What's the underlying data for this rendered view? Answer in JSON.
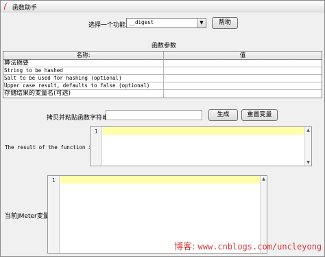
{
  "window": {
    "title": "函数助手"
  },
  "function_select": {
    "label": "选择一个功能",
    "value": "__digest",
    "arrow": "▼"
  },
  "buttons": {
    "help": "帮助",
    "generate": "生成",
    "reset": "重置变量"
  },
  "params": {
    "title": "函数参数",
    "columns": [
      "名称:",
      "值"
    ],
    "rows": [
      {
        "name": "算法摘要",
        "value": "",
        "mono": false
      },
      {
        "name": "String to be hashed",
        "value": "",
        "mono": true
      },
      {
        "name": "Salt to be used for hashing (optional)",
        "value": "",
        "mono": true
      },
      {
        "name": "Upper case result, defaults to false (optional)",
        "value": "",
        "mono": true
      },
      {
        "name": "存储结果的变量名(可选)",
        "value": "",
        "mono": false
      }
    ]
  },
  "copy": {
    "label": "拷贝并粘贴函数字符串",
    "value": ""
  },
  "result": {
    "label": "The result of the function is",
    "line_number": "1"
  },
  "jmeter_var": {
    "label": "当前JMeter变量",
    "line_number": "1"
  },
  "watermark": {
    "prefix": "博客:",
    "url": "www.cnblogs.com/uncleyong"
  },
  "colors": {
    "line_highlight": "#ffffaa",
    "watermark": "#d23a3a",
    "icon": "#d42c2c"
  },
  "icons": [
    "feather-icon",
    "chevron-down-icon",
    "scroll-up-icon",
    "scroll-down-icon"
  ]
}
